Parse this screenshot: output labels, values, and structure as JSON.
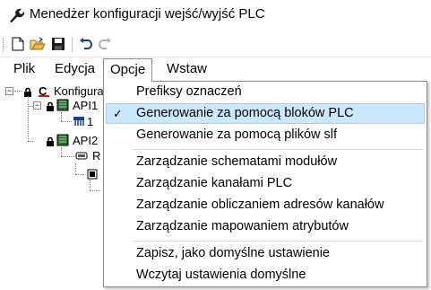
{
  "window": {
    "title": "Menedżer konfiguracji wejść/wyjść PLC"
  },
  "toolbar": {
    "buttons": [
      {
        "icon": "new-document-icon"
      },
      {
        "icon": "open-folder-icon"
      },
      {
        "icon": "save-icon"
      },
      {
        "icon": "undo-icon"
      },
      {
        "icon": "redo-icon"
      }
    ]
  },
  "menubar": {
    "items": [
      "Plik",
      "Edycja",
      "Opcje",
      "Wstaw"
    ],
    "open_index": 2
  },
  "tree": {
    "root_label": "Konfigura",
    "api1_label": "API1",
    "api1_child_label": "1",
    "api2_label": "API2",
    "api2_child_label": "R"
  },
  "dropdown": {
    "items": [
      {
        "label": "Prefiksy oznaczeń",
        "checked": false,
        "highlighted": false
      },
      {
        "label": "Generowanie za pomocą bloków PLC",
        "checked": true,
        "highlighted": true
      },
      {
        "label": "Generowanie za pomocą plików slf",
        "checked": false,
        "highlighted": false
      },
      {
        "label": "Zarządzanie schematami modułów",
        "checked": false,
        "highlighted": false
      },
      {
        "label": "Zarządzanie kanałami PLC",
        "checked": false,
        "highlighted": false
      },
      {
        "label": "Zarządzanie obliczaniem adresów kanałów",
        "checked": false,
        "highlighted": false
      },
      {
        "label": "Zarządzanie mapowaniem atrybutów",
        "checked": false,
        "highlighted": false
      },
      {
        "label": "Zapisz, jako domyślne ustawienie",
        "checked": false,
        "highlighted": false
      },
      {
        "label": "Wczytaj ustawienia domyślne",
        "checked": false,
        "highlighted": false
      }
    ],
    "check_glyph": "✓"
  },
  "colors": {
    "highlight_bg": "#cce8ff",
    "highlight_border": "#99d1ff",
    "menu_border": "#8c8c8c"
  }
}
